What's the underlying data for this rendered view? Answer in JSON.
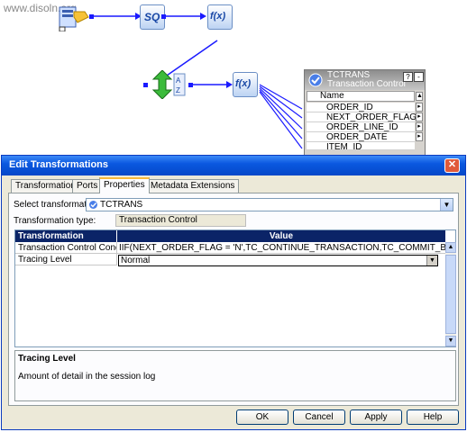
{
  "watermark": "www.disoln.org",
  "canvas": {
    "icons": [
      "source-icon",
      "source-qualifier-icon",
      "expression-icon",
      "sorter-icon",
      "expression-icon",
      "transaction-control-icon"
    ],
    "sq_label": "SQ",
    "fx_label": "f(x)"
  },
  "tc_node": {
    "title": "TCTRANS",
    "subtitle": "Transaction Control",
    "column_header": "Name",
    "ports": [
      "ORDER_ID",
      "NEXT_ORDER_FLAG",
      "ORDER_LINE_ID",
      "ORDER_DATE",
      "ITEM_ID"
    ]
  },
  "dialog": {
    "title": "Edit Transformations",
    "tabs": [
      {
        "label": "Transformation",
        "active": false
      },
      {
        "label": "Ports",
        "active": false
      },
      {
        "label": "Properties",
        "active": true
      },
      {
        "label": "Metadata Extensions",
        "active": false
      }
    ],
    "select_label": "Select transformation:",
    "selected_transformation": "TCTRANS",
    "type_label": "Transformation type:",
    "type_value": "Transaction Control",
    "grid": {
      "headers": [
        "Transformation Attribute",
        "Value"
      ],
      "rows": [
        {
          "attribute": "Transaction Control Condition",
          "value": "IIF(NEXT_ORDER_FLAG = 'N',TC_CONTINUE_TRANSACTION,TC_COMMIT_BEFORE)"
        },
        {
          "attribute": "Tracing Level",
          "value": "Normal"
        }
      ]
    },
    "description": {
      "title": "Tracing Level",
      "text": "Amount of detail in the session log"
    },
    "buttons": {
      "ok": "OK",
      "cancel": "Cancel",
      "apply": "Apply",
      "help": "Help"
    }
  },
  "colors": {
    "title_bar": "#0a58e0",
    "grid_header": "#0b2467",
    "link_lines": "#1a1aff",
    "active_tab_accent": "#f7b93b"
  }
}
